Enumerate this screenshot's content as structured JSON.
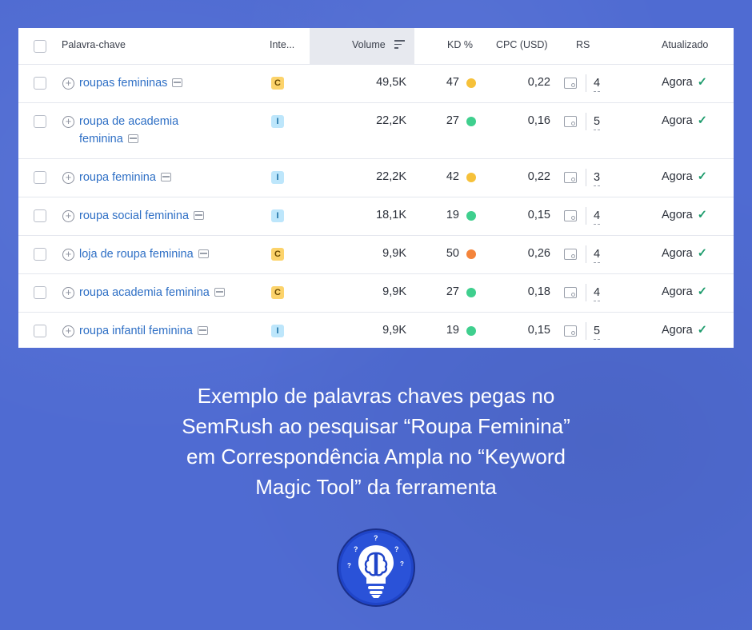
{
  "table": {
    "headers": {
      "keyword": "Palavra-chave",
      "intent": "Inte...",
      "volume": "Volume",
      "kd": "KD %",
      "cpc": "CPC (USD)",
      "rs": "RS",
      "updated": "Atualizado"
    },
    "rows": [
      {
        "keyword_line1": "roupas femininas",
        "keyword_line2": "",
        "intent": "C",
        "volume": "49,5K",
        "kd": "47",
        "kd_color": "#f6c13a",
        "cpc": "0,22",
        "rs": "4",
        "updated": "Agora"
      },
      {
        "keyword_line1": "roupa de academia",
        "keyword_line2": "feminina",
        "intent": "I",
        "volume": "22,2K",
        "kd": "27",
        "kd_color": "#3fcf8e",
        "cpc": "0,16",
        "rs": "5",
        "updated": "Agora"
      },
      {
        "keyword_line1": "roupa feminina",
        "keyword_line2": "",
        "intent": "I",
        "volume": "22,2K",
        "kd": "42",
        "kd_color": "#f6c13a",
        "cpc": "0,22",
        "rs": "3",
        "updated": "Agora"
      },
      {
        "keyword_line1": "roupa social feminina",
        "keyword_line2": "",
        "intent": "I",
        "volume": "18,1K",
        "kd": "19",
        "kd_color": "#3fcf8e",
        "cpc": "0,15",
        "rs": "4",
        "updated": "Agora"
      },
      {
        "keyword_line1": "loja de roupa feminina",
        "keyword_line2": "",
        "intent": "C",
        "volume": "9,9K",
        "kd": "50",
        "kd_color": "#f4843b",
        "cpc": "0,26",
        "rs": "4",
        "updated": "Agora"
      },
      {
        "keyword_line1": "roupa academia feminina",
        "keyword_line2": "",
        "intent": "C",
        "volume": "9,9K",
        "kd": "27",
        "kd_color": "#3fcf8e",
        "cpc": "0,18",
        "rs": "4",
        "updated": "Agora"
      },
      {
        "keyword_line1": "roupa infantil feminina",
        "keyword_line2": "",
        "intent": "I",
        "volume": "9,9K",
        "kd": "19",
        "kd_color": "#3fcf8e",
        "cpc": "0,15",
        "rs": "5",
        "updated": "Agora"
      }
    ]
  },
  "caption": {
    "line1": "Exemplo de palavras chaves pegas no",
    "line2": "SemRush ao pesquisar “Roupa Feminina”",
    "line3": "em Correspondência Ampla no “Keyword",
    "line4": "Magic Tool” da ferramenta"
  },
  "logo": {
    "icon": "brain-lightbulb-icon",
    "marks": [
      "?",
      "?",
      "?",
      "?",
      "?"
    ]
  }
}
